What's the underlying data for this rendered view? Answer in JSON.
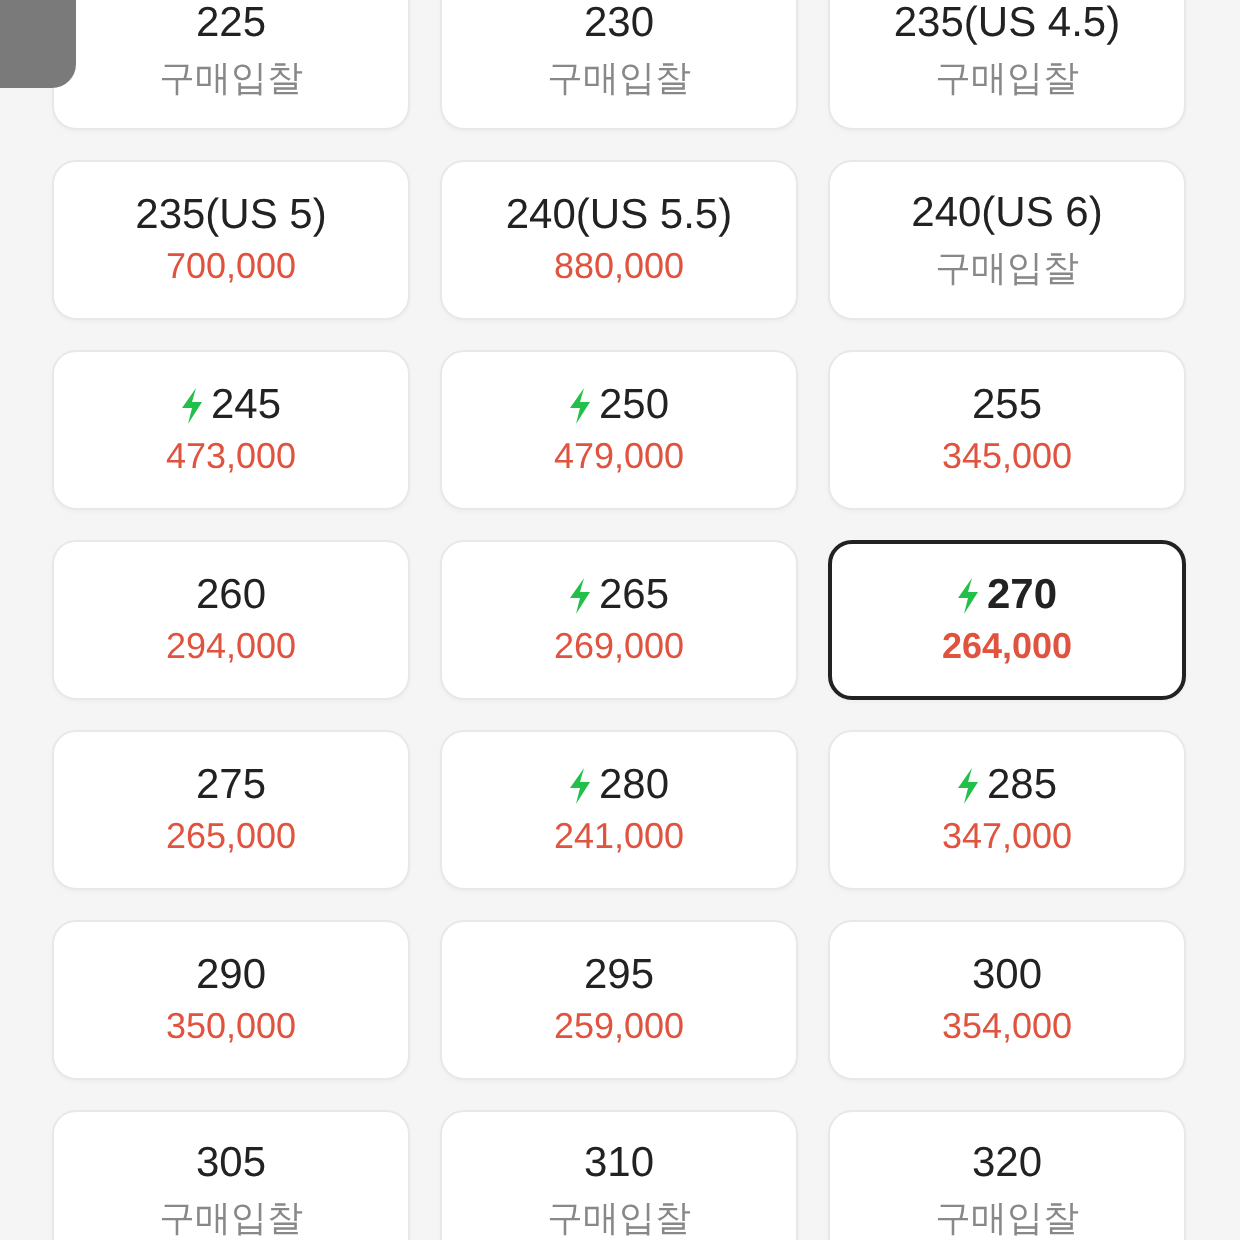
{
  "sizes": [
    {
      "label": "225",
      "price": "구매입찰",
      "kind": "bid",
      "fast": false,
      "selected": false
    },
    {
      "label": "230",
      "price": "구매입찰",
      "kind": "bid",
      "fast": false,
      "selected": false
    },
    {
      "label": "235(US 4.5)",
      "price": "구매입찰",
      "kind": "bid",
      "fast": false,
      "selected": false
    },
    {
      "label": "235(US 5)",
      "price": "700,000",
      "kind": "price",
      "fast": false,
      "selected": false
    },
    {
      "label": "240(US 5.5)",
      "price": "880,000",
      "kind": "price",
      "fast": false,
      "selected": false
    },
    {
      "label": "240(US 6)",
      "price": "구매입찰",
      "kind": "bid",
      "fast": false,
      "selected": false
    },
    {
      "label": "245",
      "price": "473,000",
      "kind": "price",
      "fast": true,
      "selected": false
    },
    {
      "label": "250",
      "price": "479,000",
      "kind": "price",
      "fast": true,
      "selected": false
    },
    {
      "label": "255",
      "price": "345,000",
      "kind": "price",
      "fast": false,
      "selected": false
    },
    {
      "label": "260",
      "price": "294,000",
      "kind": "price",
      "fast": false,
      "selected": false
    },
    {
      "label": "265",
      "price": "269,000",
      "kind": "price",
      "fast": true,
      "selected": false
    },
    {
      "label": "270",
      "price": "264,000",
      "kind": "price",
      "fast": true,
      "selected": true
    },
    {
      "label": "275",
      "price": "265,000",
      "kind": "price",
      "fast": false,
      "selected": false
    },
    {
      "label": "280",
      "price": "241,000",
      "kind": "price",
      "fast": true,
      "selected": false
    },
    {
      "label": "285",
      "price": "347,000",
      "kind": "price",
      "fast": true,
      "selected": false
    },
    {
      "label": "290",
      "price": "350,000",
      "kind": "price",
      "fast": false,
      "selected": false
    },
    {
      "label": "295",
      "price": "259,000",
      "kind": "price",
      "fast": false,
      "selected": false
    },
    {
      "label": "300",
      "price": "354,000",
      "kind": "price",
      "fast": false,
      "selected": false
    },
    {
      "label": "305",
      "price": "구매입찰",
      "kind": "bid",
      "fast": false,
      "selected": false
    },
    {
      "label": "310",
      "price": "구매입찰",
      "kind": "bid",
      "fast": false,
      "selected": false
    },
    {
      "label": "320",
      "price": "구매입찰",
      "kind": "bid",
      "fast": false,
      "selected": false
    }
  ]
}
